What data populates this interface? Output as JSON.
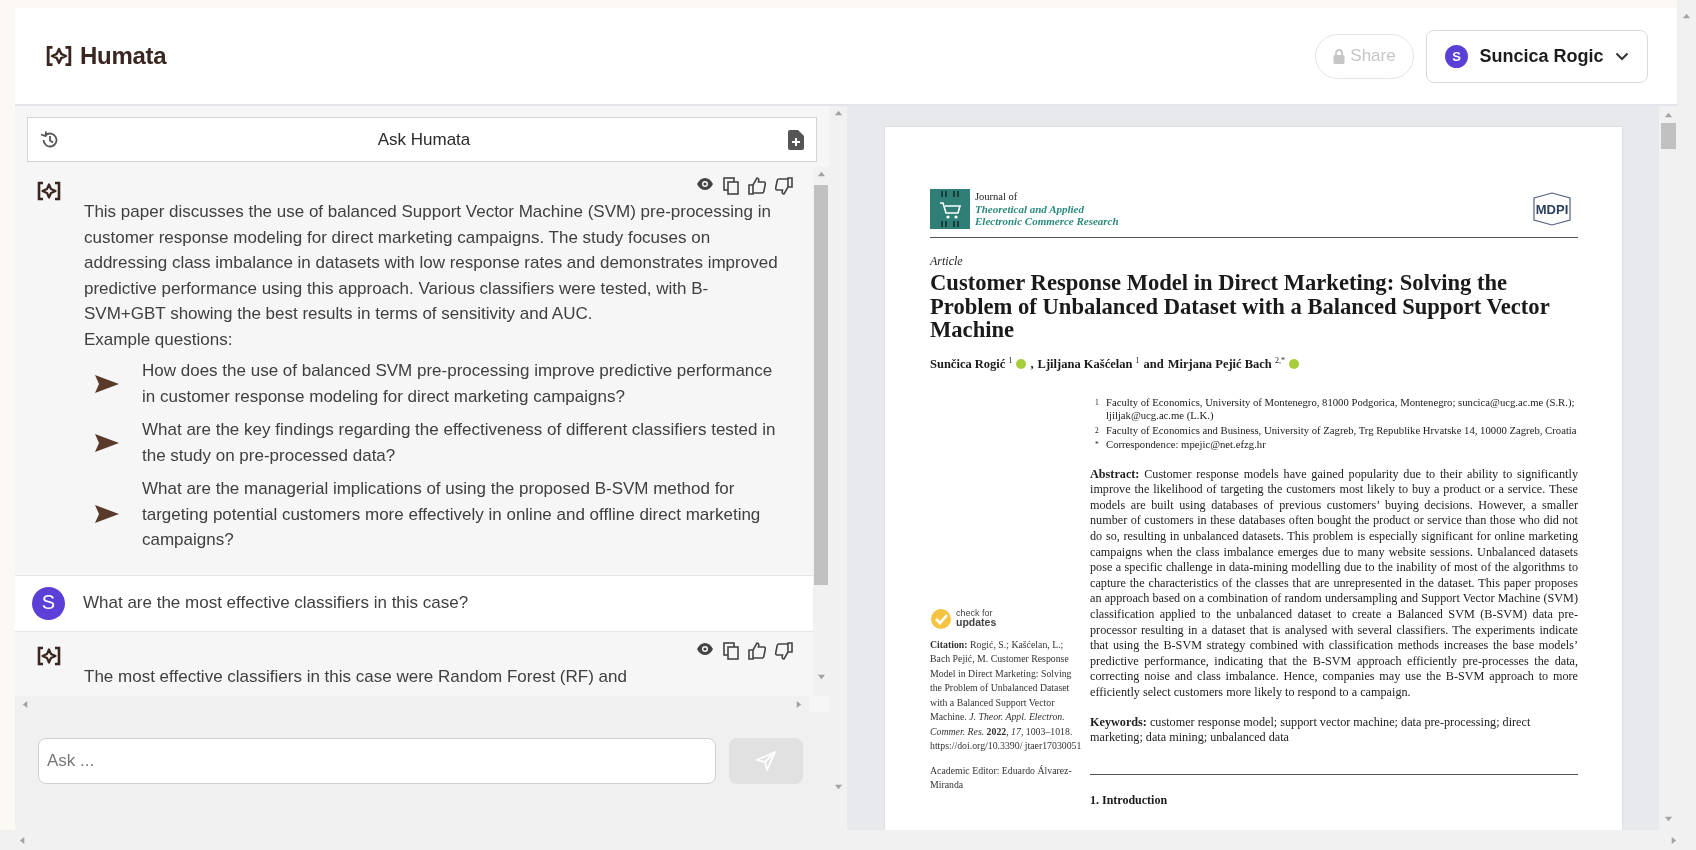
{
  "app": {
    "name": "Humata"
  },
  "header": {
    "share": {
      "label": "Share",
      "disabled": true
    },
    "user": {
      "initial": "S",
      "name": "Suncica Rogic"
    }
  },
  "chat": {
    "title": "Ask Humata",
    "messages": [
      {
        "kind": "assistant",
        "text": "This paper discusses the use of balanced Support Vector Machine (SVM) pre-processing in customer response modeling for direct marketing campaigns. The study focuses on addressing class imbalance in datasets with low response rates and demonstrates improved predictive performance using this approach. Various classifiers were tested, with B-SVM+GBT showing the best results in terms of sensitivity and AUC.",
        "example_heading": "Example questions:",
        "questions": [
          "How does the use of balanced SVM pre-processing improve predictive performance in customer response modeling for direct marketing campaigns?",
          "What are the key findings regarding the effectiveness of different classifiers tested in the study on pre-processed data?",
          "What are the managerial implications of using the proposed B-SVM method for targeting potential customers more effectively in online and offline direct marketing campaigns?"
        ]
      },
      {
        "kind": "user",
        "initial": "S",
        "text": "What are the most effective classifiers in this case?"
      },
      {
        "kind": "assistant",
        "text": "The most effective classifiers in this case were Random Forest (RF) and"
      }
    ],
    "input": {
      "placeholder": "Ask ..."
    }
  },
  "document": {
    "journal_prefix": "Journal of",
    "journal_name": [
      "Theoretical and Applied",
      "Electronic Commerce Research"
    ],
    "publisher": "MDPI",
    "article_type": "Article",
    "title": "Customer Response Model in Direct Marketing: Solving the Problem of Unbalanced Dataset with a Balanced Support Vector Machine",
    "authors": [
      {
        "name": "Sunčica Rogić",
        "mark": "1",
        "orcid": true
      },
      {
        "joiner": ",",
        "name": "Ljiljana Kašćelan",
        "mark": "1",
        "orcid": false
      },
      {
        "joiner": "and",
        "name": "Mirjana Pejić Bach",
        "mark": "2,*",
        "orcid": true
      }
    ],
    "affiliations": [
      {
        "mark": "1",
        "text": "Faculty of Economics, University of Montenegro, 81000 Podgorica, Montenegro; suncica@ucg.ac.me (S.R.); ljiljak@ucg.ac.me (L.K.)"
      },
      {
        "mark": "2",
        "text": "Faculty of Economics and Business, University of Zagreb, Trg Republike Hrvatske 14, 10000 Zagreb, Croatia"
      },
      {
        "mark": "*",
        "text": "Correspondence: mpejic@net.efzg.hr"
      }
    ],
    "abstract": "**Abstract:** Customer response models have gained popularity due to their ability to significantly improve the likelihood of targeting the customers most likely to buy a product or a service. These models are built using databases of previous customers’ buying decisions.  However, a smaller number of customers in these databases often bought the product or service than those who did not do so, resulting in unbalanced datasets. This problem is especially significant for online marketing campaigns when the class imbalance emerges due to many website sessions. Unbalanced datasets pose a specific challenge in data-mining modelling due to the inability of most of the algorithms to capture the characteristics of the classes that are unrepresented in the dataset. This paper proposes an approach based on a combination of random undersampling and Support Vector Machine (SVM) classification applied to the unbalanced dataset to create a Balanced SVM (B-SVM) data pre-processor resulting in a dataset that is analysed with several classifiers. The experiments indicate that using the B-SVM strategy combined with classification methods increases the base models’ predictive performance, indicating that the B-SVM approach efficiently pre-processes the data, correcting noise and class imbalance.  Hence, companies may use the B-SVM approach to more efficiently select customers more likely to respond to a campaign.",
    "keywords": "**Keywords:** customer response model; support vector machine; data pre-processing; direct marketing; data mining; unbalanced data",
    "check_updates": [
      "check for",
      "updates"
    ],
    "citation": "**Citation:** Rogić, S.; Kašćelan, L.; Bach Pejić, M. Customer Response Model in Direct Marketing: Solving the Problem of Unbalanced Dataset with a Balanced Support Vector Machine. *J. Theor. Appl. Electron. Commer. Res.* **2022**, *17*, 1003–1018. https://doi.org/10.3390/ jtaer17030051",
    "academic_editor": "Academic Editor: Eduardo Álvarez-Miranda",
    "section_heading": "1. Introduction"
  }
}
